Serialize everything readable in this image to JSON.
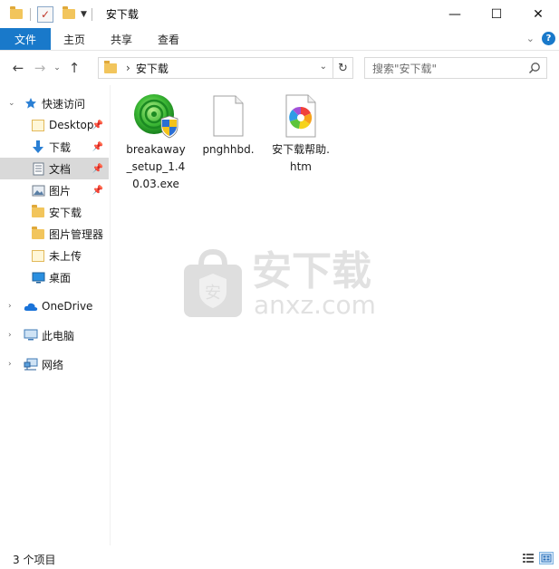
{
  "window": {
    "title": "安下载",
    "minimize_glyph": "—",
    "maximize_glyph": "☐",
    "close_glyph": "✕"
  },
  "ribbon": {
    "tabs": [
      {
        "label": "文件"
      },
      {
        "label": "主页"
      },
      {
        "label": "共享"
      },
      {
        "label": "查看"
      }
    ]
  },
  "address": {
    "breadcrumb": "安下载",
    "search_placeholder": "搜索\"安下载\""
  },
  "sidebar": {
    "quick_access": "快速访问",
    "items": [
      {
        "label": "Desktop",
        "icon": "folder-icon",
        "pinned": true
      },
      {
        "label": "下载",
        "icon": "download-arrow-icon",
        "pinned": true
      },
      {
        "label": "文档",
        "icon": "document-icon",
        "pinned": true
      },
      {
        "label": "图片",
        "icon": "pictures-icon",
        "pinned": true
      },
      {
        "label": "安下载",
        "icon": "folder-icon",
        "pinned": false
      },
      {
        "label": "图片管理器",
        "icon": "folder-icon",
        "pinned": false
      },
      {
        "label": "未上传",
        "icon": "folder-icon",
        "pinned": false
      },
      {
        "label": "桌面",
        "icon": "desktop-icon",
        "pinned": false
      }
    ],
    "onedrive": "OneDrive",
    "this_pc": "此电脑",
    "network": "网络"
  },
  "files": [
    {
      "name": "breakaway_setup_1.40.03.exe",
      "icon": "installer-exe-icon"
    },
    {
      "name": "pnghhbd.",
      "icon": "blank-file-icon"
    },
    {
      "name": "安下载帮助.htm",
      "icon": "htm-file-icon"
    }
  ],
  "watermark": {
    "cn": "安下载",
    "en": "anxz.com",
    "badge": "安"
  },
  "status": {
    "item_count": "3 个项目"
  },
  "colors": {
    "accent": "#1979ca",
    "folder": "#f2c55c",
    "selection": "#d9d9d9"
  }
}
